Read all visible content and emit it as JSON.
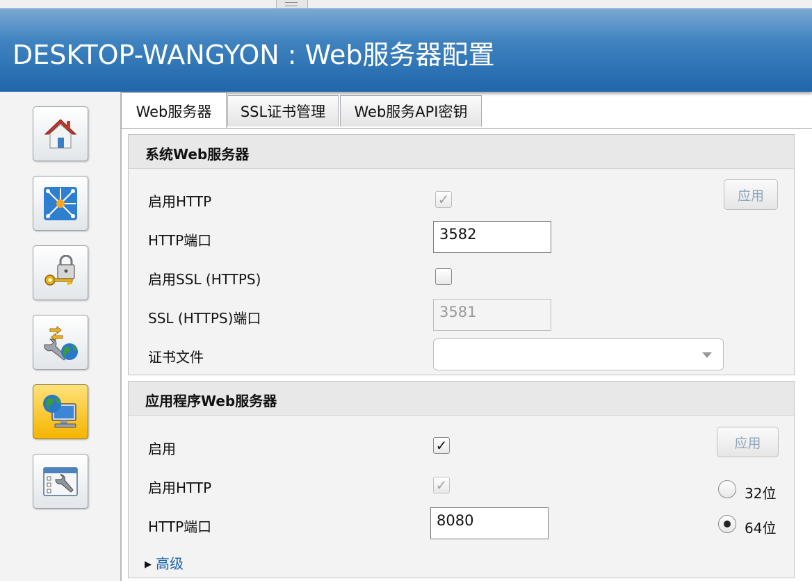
{
  "window": {
    "title": "DESKTOP-WANGYON : Web服务器配置"
  },
  "sidebar": {
    "items": [
      {
        "name": "home",
        "icon": "home-icon"
      },
      {
        "name": "network",
        "icon": "network-icon"
      },
      {
        "name": "security",
        "icon": "lock-key-icon"
      },
      {
        "name": "connectivity",
        "icon": "wrench-globe-icon"
      },
      {
        "name": "web-server",
        "icon": "globe-computer-icon",
        "active": true
      },
      {
        "name": "settings",
        "icon": "settings-window-icon"
      }
    ]
  },
  "tabs": [
    {
      "label": "Web服务器",
      "active": true
    },
    {
      "label": "SSL证书管理",
      "active": false
    },
    {
      "label": "Web服务API密钥",
      "active": false
    }
  ],
  "system_web_server": {
    "title": "系统Web服务器",
    "enable_http_label": "启用HTTP",
    "enable_http_checked": true,
    "http_port_label": "HTTP端口",
    "http_port_value": "3582",
    "enable_ssl_label": "启用SSL (HTTPS)",
    "enable_ssl_checked": false,
    "ssl_port_label": "SSL (HTTPS)端口",
    "ssl_port_value": "3581",
    "cert_file_label": "证书文件",
    "cert_file_value": "",
    "apply_label": "应用"
  },
  "app_web_server": {
    "title": "应用程序Web服务器",
    "enable_label": "启用",
    "enable_checked": true,
    "enable_http_label": "启用HTTP",
    "enable_http_checked": true,
    "http_port_label": "HTTP端口",
    "http_port_value": "8080",
    "apply_label": "应用",
    "bit32_label": "32位",
    "bit64_label": "64位",
    "bitness_selected": "64位",
    "advanced_label": "高级"
  },
  "colors": {
    "header": "#2a74b6",
    "active_nav": "#f5b400",
    "link": "#1a64b0"
  }
}
